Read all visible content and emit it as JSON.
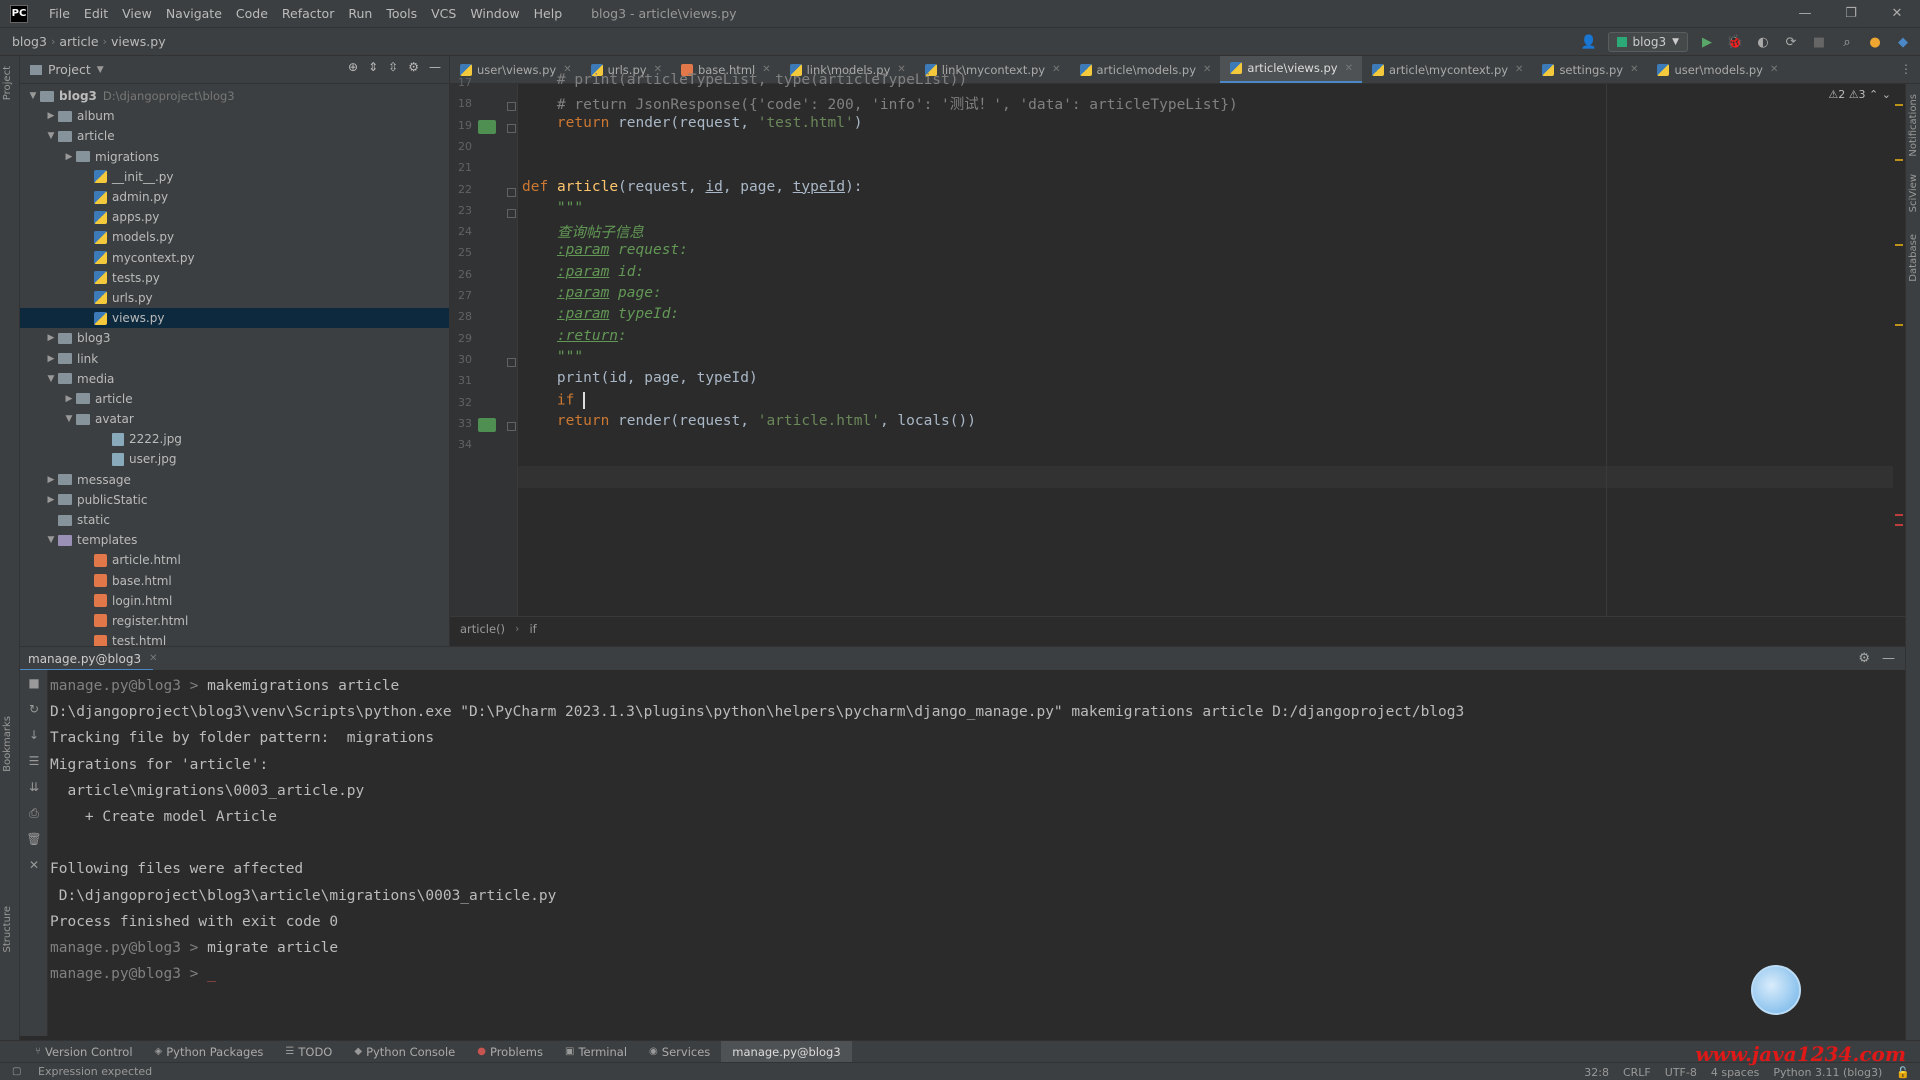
{
  "menubar": {
    "items": [
      "File",
      "Edit",
      "View",
      "Navigate",
      "Code",
      "Refactor",
      "Run",
      "Tools",
      "VCS",
      "Window",
      "Help"
    ],
    "title": "blog3 - article\\views.py",
    "controls": [
      "—",
      "❐",
      "✕"
    ]
  },
  "navbar": {
    "crumbs": [
      "blog3",
      "article",
      "views.py"
    ],
    "run_config": "blog3"
  },
  "project": {
    "title": "Project",
    "tree": [
      {
        "indent": 0,
        "arrow": "▼",
        "type": "folder",
        "label": "blog3",
        "hint": "D:\\djangoproject\\blog3"
      },
      {
        "indent": 1,
        "arrow": "▶",
        "type": "folder",
        "label": "album"
      },
      {
        "indent": 1,
        "arrow": "▼",
        "type": "folder",
        "label": "article"
      },
      {
        "indent": 2,
        "arrow": "▶",
        "type": "folder",
        "label": "migrations"
      },
      {
        "indent": 3,
        "arrow": "",
        "type": "py",
        "label": "__init__.py"
      },
      {
        "indent": 3,
        "arrow": "",
        "type": "py",
        "label": "admin.py"
      },
      {
        "indent": 3,
        "arrow": "",
        "type": "py",
        "label": "apps.py"
      },
      {
        "indent": 3,
        "arrow": "",
        "type": "py",
        "label": "models.py"
      },
      {
        "indent": 3,
        "arrow": "",
        "type": "py",
        "label": "mycontext.py"
      },
      {
        "indent": 3,
        "arrow": "",
        "type": "py",
        "label": "tests.py"
      },
      {
        "indent": 3,
        "arrow": "",
        "type": "py",
        "label": "urls.py"
      },
      {
        "indent": 3,
        "arrow": "",
        "type": "py",
        "label": "views.py",
        "selected": true
      },
      {
        "indent": 1,
        "arrow": "▶",
        "type": "folder",
        "label": "blog3"
      },
      {
        "indent": 1,
        "arrow": "▶",
        "type": "folder",
        "label": "link"
      },
      {
        "indent": 1,
        "arrow": "▼",
        "type": "folder",
        "label": "media"
      },
      {
        "indent": 2,
        "arrow": "▶",
        "type": "folder",
        "label": "article"
      },
      {
        "indent": 2,
        "arrow": "▼",
        "type": "folder",
        "label": "avatar"
      },
      {
        "indent": 4,
        "arrow": "",
        "type": "img",
        "label": "2222.jpg"
      },
      {
        "indent": 4,
        "arrow": "",
        "type": "img",
        "label": "user.jpg"
      },
      {
        "indent": 1,
        "arrow": "▶",
        "type": "folder",
        "label": "message"
      },
      {
        "indent": 1,
        "arrow": "▶",
        "type": "folder",
        "label": "publicStatic"
      },
      {
        "indent": 1,
        "arrow": "",
        "type": "folder",
        "label": "static"
      },
      {
        "indent": 1,
        "arrow": "▼",
        "type": "folder-purple",
        "label": "templates"
      },
      {
        "indent": 3,
        "arrow": "",
        "type": "html",
        "label": "article.html"
      },
      {
        "indent": 3,
        "arrow": "",
        "type": "html",
        "label": "base.html"
      },
      {
        "indent": 3,
        "arrow": "",
        "type": "html",
        "label": "login.html"
      },
      {
        "indent": 3,
        "arrow": "",
        "type": "html",
        "label": "register.html"
      },
      {
        "indent": 3,
        "arrow": "",
        "type": "html",
        "label": "test.html"
      }
    ]
  },
  "editor": {
    "tabs": [
      {
        "label": "user\\views.py",
        "icon": "py"
      },
      {
        "label": "urls.py",
        "icon": "py"
      },
      {
        "label": "base.html",
        "icon": "html"
      },
      {
        "label": "link\\models.py",
        "icon": "py"
      },
      {
        "label": "link\\mycontext.py",
        "icon": "py"
      },
      {
        "label": "article\\models.py",
        "icon": "py"
      },
      {
        "label": "article\\views.py",
        "icon": "py",
        "active": true
      },
      {
        "label": "article\\mycontext.py",
        "icon": "py"
      },
      {
        "label": "settings.py",
        "icon": "py"
      },
      {
        "label": "user\\models.py",
        "icon": "py"
      }
    ],
    "inspections": "⚠2  ⚠3  ⌃  ⌄",
    "line_numbers": [
      "17",
      "18",
      "19",
      "20",
      "21",
      "22",
      "23",
      "24",
      "25",
      "26",
      "27",
      "28",
      "29",
      "30",
      "31",
      "32",
      "33",
      "34"
    ],
    "lines": [
      {
        "html": "<span class=\"cmt\">    # print(articleTypeList, type(articleTypeList))</span>"
      },
      {
        "html": "<span class=\"cmt\">    # return JsonResponse({'code': 200, 'info': '测试！', 'data': articleTypeList})</span>"
      },
      {
        "html": "    <span class=\"kw\">return</span> render(request, <span class=\"str\">'test.html'</span>)"
      },
      {
        "html": ""
      },
      {
        "html": ""
      },
      {
        "html": "<span class=\"kw\">def</span> <span class=\"fn\">article</span>(request, <span class=\"param\">id</span>, page, <span class=\"param\">typeId</span>):"
      },
      {
        "html": "    <span class=\"doc\">\"\"\"</span>"
      },
      {
        "html": "    <span class=\"doc\">查询帖子信息</span>"
      },
      {
        "html": "    <span class=\"doctag\">:param</span><span class=\"doc\"> request:</span>"
      },
      {
        "html": "    <span class=\"doctag\">:param</span><span class=\"doc\"> id:</span>"
      },
      {
        "html": "    <span class=\"doctag\">:param</span><span class=\"doc\"> page:</span>"
      },
      {
        "html": "    <span class=\"doctag\">:param</span><span class=\"doc\"> typeId:</span>"
      },
      {
        "html": "    <span class=\"doctag\">:return</span><span class=\"doc\">:</span>"
      },
      {
        "html": "    <span class=\"doc\">\"\"\"</span>"
      },
      {
        "html": "    print(id, page, typeId)"
      },
      {
        "html": "    <span class=\"kw\">if</span> <span id=\"caret\"></span>"
      },
      {
        "html": "    <span class=\"kw\">return</span> render(request, <span class=\"str\">'article.html'</span>, locals())"
      },
      {
        "html": ""
      }
    ],
    "breadcrumb": [
      "article()",
      "if"
    ]
  },
  "run": {
    "tab_label": "manage.py@blog3",
    "console": [
      {
        "prompt": "manage.py@blog3 > ",
        "text": "makemigrations article"
      },
      {
        "prompt": "",
        "text": "D:\\djangoproject\\blog3\\venv\\Scripts\\python.exe \"D:\\PyCharm 2023.1.3\\plugins\\python\\helpers\\pycharm\\django_manage.py\" makemigrations article D:/djangoproject/blog3"
      },
      {
        "prompt": "",
        "text": "Tracking file by folder pattern:  migrations"
      },
      {
        "prompt": "",
        "text": "Migrations for 'article':"
      },
      {
        "prompt": "",
        "text": "  article\\migrations\\0003_article.py"
      },
      {
        "prompt": "",
        "text": "    + Create model Article"
      },
      {
        "prompt": "",
        "text": ""
      },
      {
        "prompt": "",
        "text": "Following files were affected"
      },
      {
        "prompt": "",
        "text": " D:\\djangoproject\\blog3\\article\\migrations\\0003_article.py"
      },
      {
        "prompt": "",
        "text": "Process finished with exit code 0"
      },
      {
        "prompt": "manage.py@blog3 > ",
        "text": "migrate article"
      },
      {
        "prompt": "manage.py@blog3 > ",
        "text": ""
      }
    ]
  },
  "bottom_tabs": [
    {
      "label": "Version Control",
      "icon": "⑂"
    },
    {
      "label": "Python Packages",
      "icon": "◈"
    },
    {
      "label": "TODO",
      "icon": "☰"
    },
    {
      "label": "Python Console",
      "icon": "◆"
    },
    {
      "label": "Problems",
      "icon": "●",
      "red": true
    },
    {
      "label": "Terminal",
      "icon": "▣"
    },
    {
      "label": "Services",
      "icon": "◉"
    },
    {
      "label": "manage.py@blog3",
      "icon": "",
      "active": true
    }
  ],
  "status": {
    "message": "Expression expected",
    "position": "32:8",
    "line_sep": "CRLF",
    "encoding": "UTF-8",
    "indent": "4 spaces",
    "interpreter": "Python 3.11 (blog3)"
  },
  "watermark": "www.java1234.com"
}
